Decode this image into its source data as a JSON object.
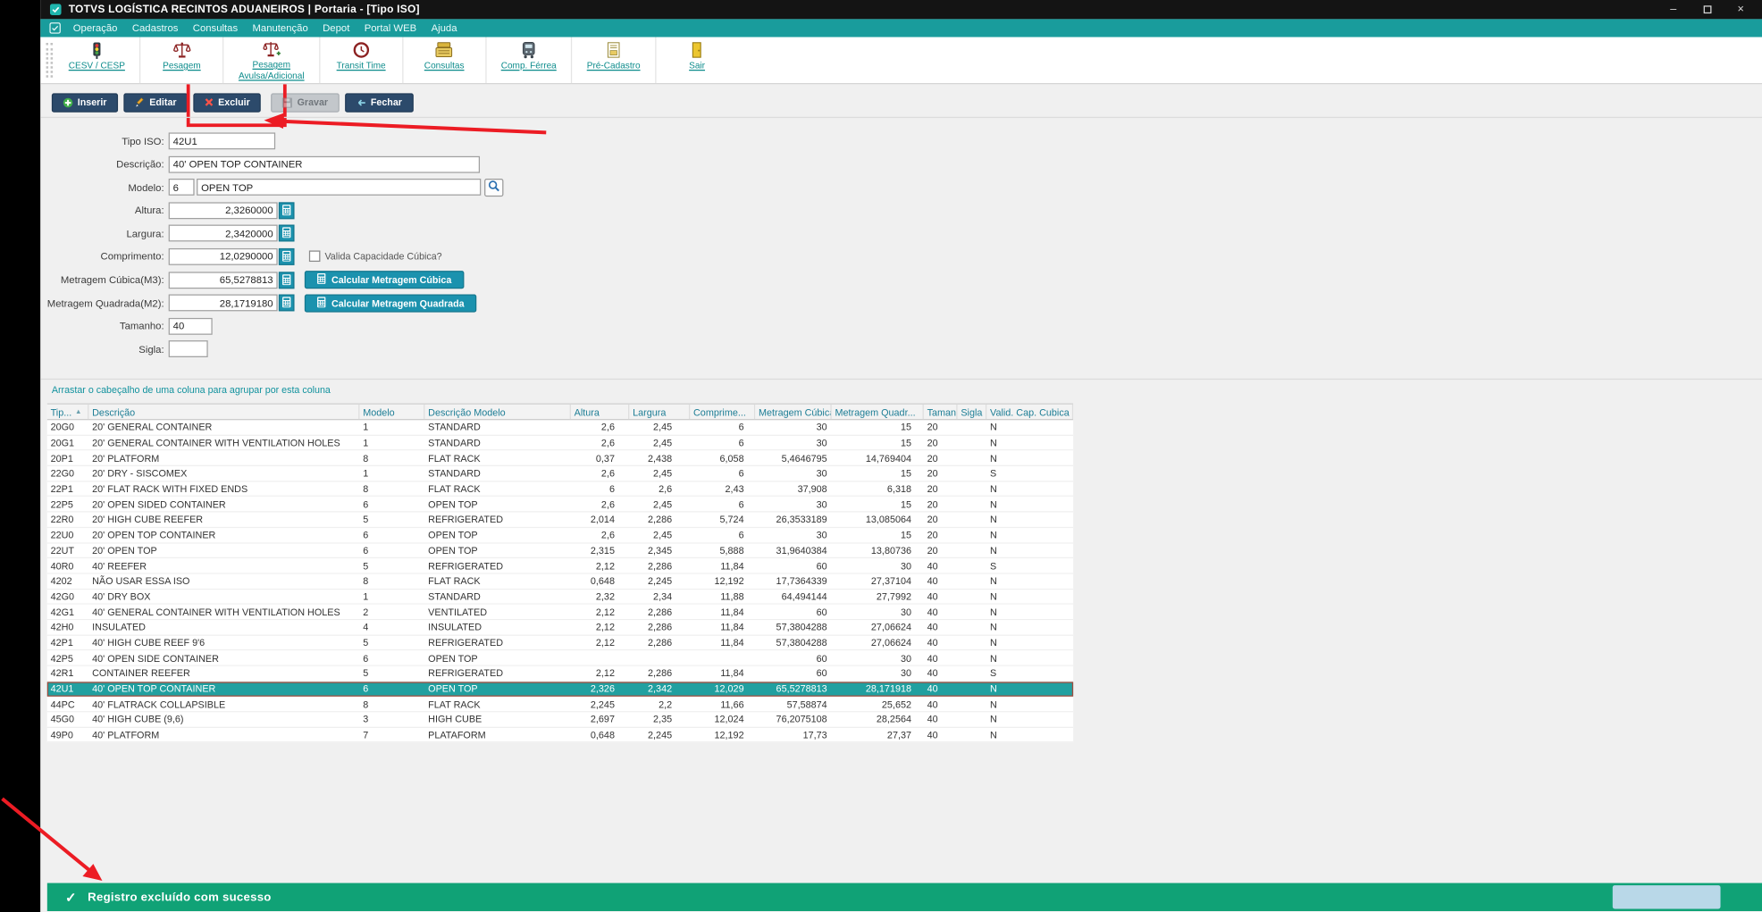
{
  "window": {
    "title": "TOTVS LOGÍSTICA RECINTOS ADUANEIROS | Portaria - [Tipo ISO]",
    "controls": [
      "minimize",
      "maximize",
      "close"
    ]
  },
  "menubar": {
    "items": [
      "Operação",
      "Cadastros",
      "Consultas",
      "Manutenção",
      "Depot",
      "Portal WEB",
      "Ajuda"
    ]
  },
  "toolbar": {
    "items": [
      {
        "label": "CESV / CESP",
        "icon": "traffic-light-icon"
      },
      {
        "label": "Pesagem",
        "icon": "scale-icon"
      },
      {
        "label": "Pesagem\nAvulsa/Adicional",
        "icon": "scale-plus-icon"
      },
      {
        "label": "Transit Time",
        "icon": "clock-icon"
      },
      {
        "label": "Consultas",
        "icon": "cash-register-icon"
      },
      {
        "label": "Comp. Férrea",
        "icon": "train-icon"
      },
      {
        "label": "Pré-Cadastro",
        "icon": "form-icon"
      },
      {
        "label": "Sair",
        "icon": "exit-door-icon"
      }
    ]
  },
  "actions": {
    "inserir": {
      "label": "Inserir",
      "icon": "insert-icon"
    },
    "editar": {
      "label": "Editar",
      "icon": "edit-pencil-icon"
    },
    "excluir": {
      "label": "Excluir",
      "icon": "delete-x-icon"
    },
    "gravar": {
      "label": "Gravar",
      "icon": "save-disk-icon",
      "disabled": true
    },
    "fechar": {
      "label": "Fechar",
      "icon": "close-return-icon"
    }
  },
  "form": {
    "tipo_iso": {
      "label": "Tipo ISO:",
      "value": "42U1"
    },
    "descricao": {
      "label": "Descrição:",
      "value": "40' OPEN TOP CONTAINER"
    },
    "modelo": {
      "label": "Modelo:",
      "code": "6",
      "value": "OPEN TOP"
    },
    "altura": {
      "label": "Altura:",
      "value": "2,3260000"
    },
    "largura": {
      "label": "Largura:",
      "value": "2,3420000"
    },
    "comprimento": {
      "label": "Comprimento:",
      "value": "12,0290000"
    },
    "valida_checkbox": "Valida Capacidade Cúbica?",
    "valida_checked": false,
    "metragem_cubica": {
      "label": "Metragem Cúbica(M3):",
      "value": "65,5278813",
      "button": "Calcular Metragem Cúbica"
    },
    "metragem_quadrada": {
      "label": "Metragem Quadrada(M2):",
      "value": "28,1719180",
      "button": "Calcular Metragem Quadrada"
    },
    "tamanho": {
      "label": "Tamanho:",
      "value": "40"
    },
    "sigla": {
      "label": "Sigla:",
      "value": ""
    }
  },
  "grid": {
    "group_hint": "Arrastar o cabeçalho de uma coluna para agrupar por esta coluna",
    "sort_column": "Tip...",
    "columns": [
      "Tip...",
      "Descrição",
      "Modelo",
      "Descrição Modelo",
      "Altura",
      "Largura",
      "Comprime...",
      "Metragem Cúbica",
      "Metragem Quadr...",
      "Tamanho",
      "Sigla",
      "Valid. Cap. Cubica"
    ],
    "selected_code": "42U1",
    "rows": [
      [
        "20G0",
        "20' GENERAL CONTAINER",
        "1",
        "STANDARD",
        "2,6",
        "2,45",
        "6",
        "30",
        "15",
        "20",
        "",
        "N"
      ],
      [
        "20G1",
        "20' GENERAL CONTAINER WITH VENTILATION HOLES",
        "1",
        "STANDARD",
        "2,6",
        "2,45",
        "6",
        "30",
        "15",
        "20",
        "",
        "N"
      ],
      [
        "20P1",
        "20' PLATFORM",
        "8",
        "FLAT RACK",
        "0,37",
        "2,438",
        "6,058",
        "5,4646795",
        "14,769404",
        "20",
        "",
        "N"
      ],
      [
        "22G0",
        "20' DRY - SISCOMEX",
        "1",
        "STANDARD",
        "2,6",
        "2,45",
        "6",
        "30",
        "15",
        "20",
        "",
        "S"
      ],
      [
        "22P1",
        "20' FLAT RACK WITH FIXED ENDS",
        "8",
        "FLAT RACK",
        "6",
        "2,6",
        "2,43",
        "37,908",
        "6,318",
        "20",
        "",
        "N"
      ],
      [
        "22P5",
        "20' OPEN SIDED CONTAINER",
        "6",
        "OPEN TOP",
        "2,6",
        "2,45",
        "6",
        "30",
        "15",
        "20",
        "",
        "N"
      ],
      [
        "22R0",
        "20' HIGH CUBE REEFER",
        "5",
        "REFRIGERATED",
        "2,014",
        "2,286",
        "5,724",
        "26,3533189",
        "13,085064",
        "20",
        "",
        "N"
      ],
      [
        "22U0",
        "20' OPEN TOP CONTAINER",
        "6",
        "OPEN TOP",
        "2,6",
        "2,45",
        "6",
        "30",
        "15",
        "20",
        "",
        "N"
      ],
      [
        "22UT",
        "20' OPEN TOP",
        "6",
        "OPEN TOP",
        "2,315",
        "2,345",
        "5,888",
        "31,9640384",
        "13,80736",
        "20",
        "",
        "N"
      ],
      [
        "40R0",
        "40' REEFER",
        "5",
        "REFRIGERATED",
        "2,12",
        "2,286",
        "11,84",
        "60",
        "30",
        "40",
        "",
        "S"
      ],
      [
        "4202",
        "NÃO USAR ESSA ISO",
        "8",
        "FLAT RACK",
        "0,648",
        "2,245",
        "12,192",
        "17,7364339",
        "27,37104",
        "40",
        "",
        "N"
      ],
      [
        "42G0",
        "40' DRY BOX",
        "1",
        "STANDARD",
        "2,32",
        "2,34",
        "11,88",
        "64,494144",
        "27,7992",
        "40",
        "",
        "N"
      ],
      [
        "42G1",
        "40' GENERAL CONTAINER WITH VENTILATION HOLES",
        "2",
        "VENTILATED",
        "2,12",
        "2,286",
        "11,84",
        "60",
        "30",
        "40",
        "",
        "N"
      ],
      [
        "42H0",
        "INSULATED",
        "4",
        "INSULATED",
        "2,12",
        "2,286",
        "11,84",
        "57,3804288",
        "27,06624",
        "40",
        "",
        "N"
      ],
      [
        "42P1",
        "40' HIGH CUBE REEF 9'6",
        "5",
        "REFRIGERATED",
        "2,12",
        "2,286",
        "11,84",
        "57,3804288",
        "27,06624",
        "40",
        "",
        "N"
      ],
      [
        "42P5",
        "40' OPEN SIDE CONTAINER",
        "6",
        "OPEN TOP",
        "",
        "",
        "",
        "60",
        "30",
        "40",
        "",
        "N"
      ],
      [
        "42R1",
        "CONTAINER REEFER",
        "5",
        "REFRIGERATED",
        "2,12",
        "2,286",
        "11,84",
        "60",
        "30",
        "40",
        "",
        "S"
      ],
      [
        "42U1",
        "40' OPEN TOP CONTAINER",
        "6",
        "OPEN TOP",
        "2,326",
        "2,342",
        "12,029",
        "65,5278813",
        "28,171918",
        "40",
        "",
        "N"
      ],
      [
        "44PC",
        "40' FLATRACK COLLAPSIBLE",
        "8",
        "FLAT RACK",
        "2,245",
        "2,2",
        "11,66",
        "57,58874",
        "25,652",
        "40",
        "",
        "N"
      ],
      [
        "45G0",
        "40' HIGH CUBE (9,6)",
        "3",
        "HIGH CUBE",
        "2,697",
        "2,35",
        "12,024",
        "76,2075108",
        "28,2564",
        "40",
        "",
        "N"
      ],
      [
        "49P0",
        "40' PLATFORM",
        "7",
        "PLATAFORM",
        "0,648",
        "2,245",
        "12,192",
        "17,73",
        "27,37",
        "40",
        "",
        "N"
      ]
    ]
  },
  "toast": {
    "message": "Registro excluído com sucesso",
    "icon": "check-icon"
  },
  "colors": {
    "menubar_teal": "#199c9c",
    "button_navy": "#2c4a6b",
    "action_teal": "#1b92ae",
    "selection_teal": "#21a0a0",
    "toast_green": "#10a276",
    "annotation_red": "#ec1c24"
  }
}
